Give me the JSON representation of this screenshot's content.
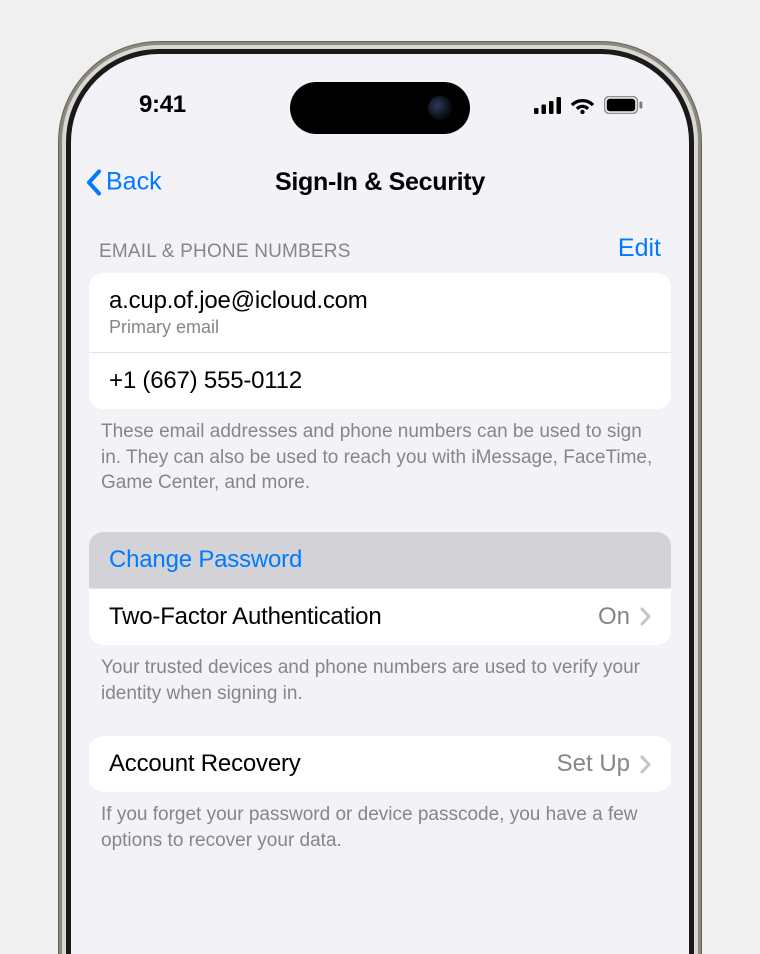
{
  "status": {
    "time": "9:41"
  },
  "nav": {
    "back": "Back",
    "title": "Sign-In & Security"
  },
  "section1": {
    "header": "EMAIL & PHONE NUMBERS",
    "edit": "Edit",
    "email": "a.cup.of.joe@icloud.com",
    "email_sub": "Primary email",
    "phone": "+1 (667) 555-0112",
    "footer": "These email addresses and phone numbers can be used to sign in. They can also be used to reach you with iMessage, FaceTime, Game Center, and more."
  },
  "section2": {
    "change_pw": "Change Password",
    "tfa_label": "Two-Factor Authentication",
    "tfa_value": "On",
    "footer": "Your trusted devices and phone numbers are used to verify your identity when signing in."
  },
  "section3": {
    "recovery_label": "Account Recovery",
    "recovery_value": "Set Up",
    "footer": "If you forget your password or device passcode, you have a few options to recover your data."
  }
}
